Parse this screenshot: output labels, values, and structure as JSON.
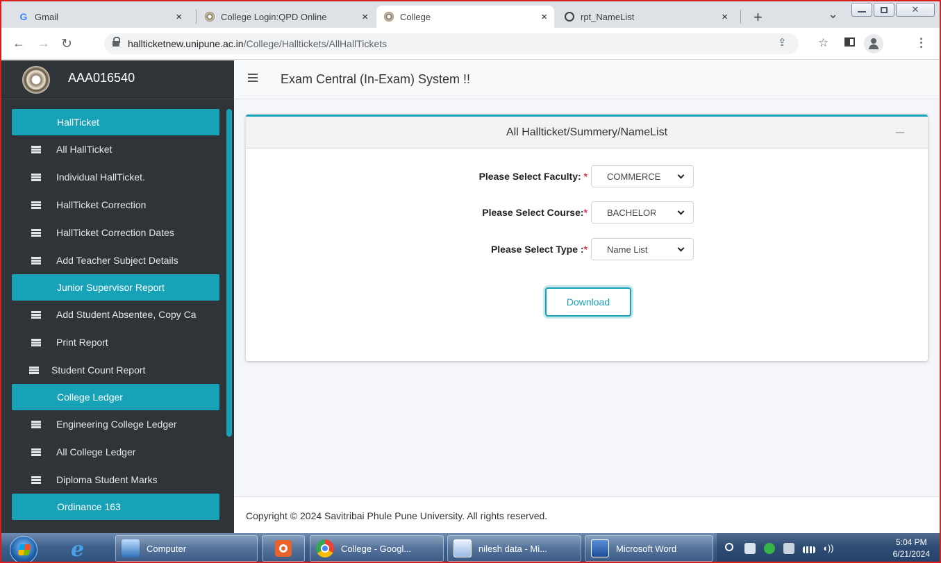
{
  "browser": {
    "tabs": [
      {
        "title": "Gmail",
        "icon": "gmail-icon"
      },
      {
        "title": "College Login:QPD Online",
        "icon": "university-seal-icon"
      },
      {
        "title": "College",
        "icon": "university-seal-icon"
      },
      {
        "title": "rpt_NameList",
        "icon": "globe-icon"
      }
    ],
    "tab_close_glyph": "×",
    "new_tab_glyph": "+",
    "dropdown_glyph": "⌄",
    "url_host": "highlight",
    "url": {
      "host": "hallticketnew.unipune.ac.in",
      "path": "/College/Halltickets/AllHallTickets"
    }
  },
  "sidebar": {
    "user_code": "AAA016540",
    "sections": [
      {
        "header": "HallTicket",
        "items": [
          "All HallTicket",
          "Individual HallTicket.",
          "HallTicket Correction",
          "HallTicket Correction Dates",
          "Add Teacher Subject Details"
        ]
      },
      {
        "header": "Junior Supervisor Report",
        "items": [
          "Add Student Absentee, Copy Ca",
          "Print Report",
          "Student Count Report"
        ]
      },
      {
        "header": "College Ledger",
        "items": [
          "Engineering College Ledger",
          "All College Ledger",
          "Diploma Student Marks"
        ]
      },
      {
        "header": "Ordinance 163",
        "items": []
      }
    ]
  },
  "header": {
    "system_title": "Exam Central (In-Exam) System !!"
  },
  "card": {
    "title": "All Hallticket/Summery/NameList",
    "faculty_label": "Please Select Faculty: ",
    "faculty_value": "COMMERCE",
    "course_label": "Please Select Course:",
    "course_value": "BACHELOR OF COMMERCE",
    "type_label": "Please Select Type :",
    "type_value": "Name List",
    "required_mark": "*",
    "download_label": "Download"
  },
  "footer": {
    "copyright": "Copyright © 2024 Savitribai Phule Pune University. All rights reserved."
  },
  "taskbar": {
    "items": [
      {
        "label": "Computer"
      },
      {
        "label": ""
      },
      {
        "label": "College - Googl..."
      },
      {
        "label": "nilesh data - Mi..."
      },
      {
        "label": "Microsoft Word"
      }
    ],
    "time": "5:04 PM",
    "date": "6/21/2024"
  },
  "colors": {
    "accent": "#17a2b8",
    "sidebar_bg": "#2f3439",
    "required": "#dc3545",
    "frame": "#d62020"
  }
}
